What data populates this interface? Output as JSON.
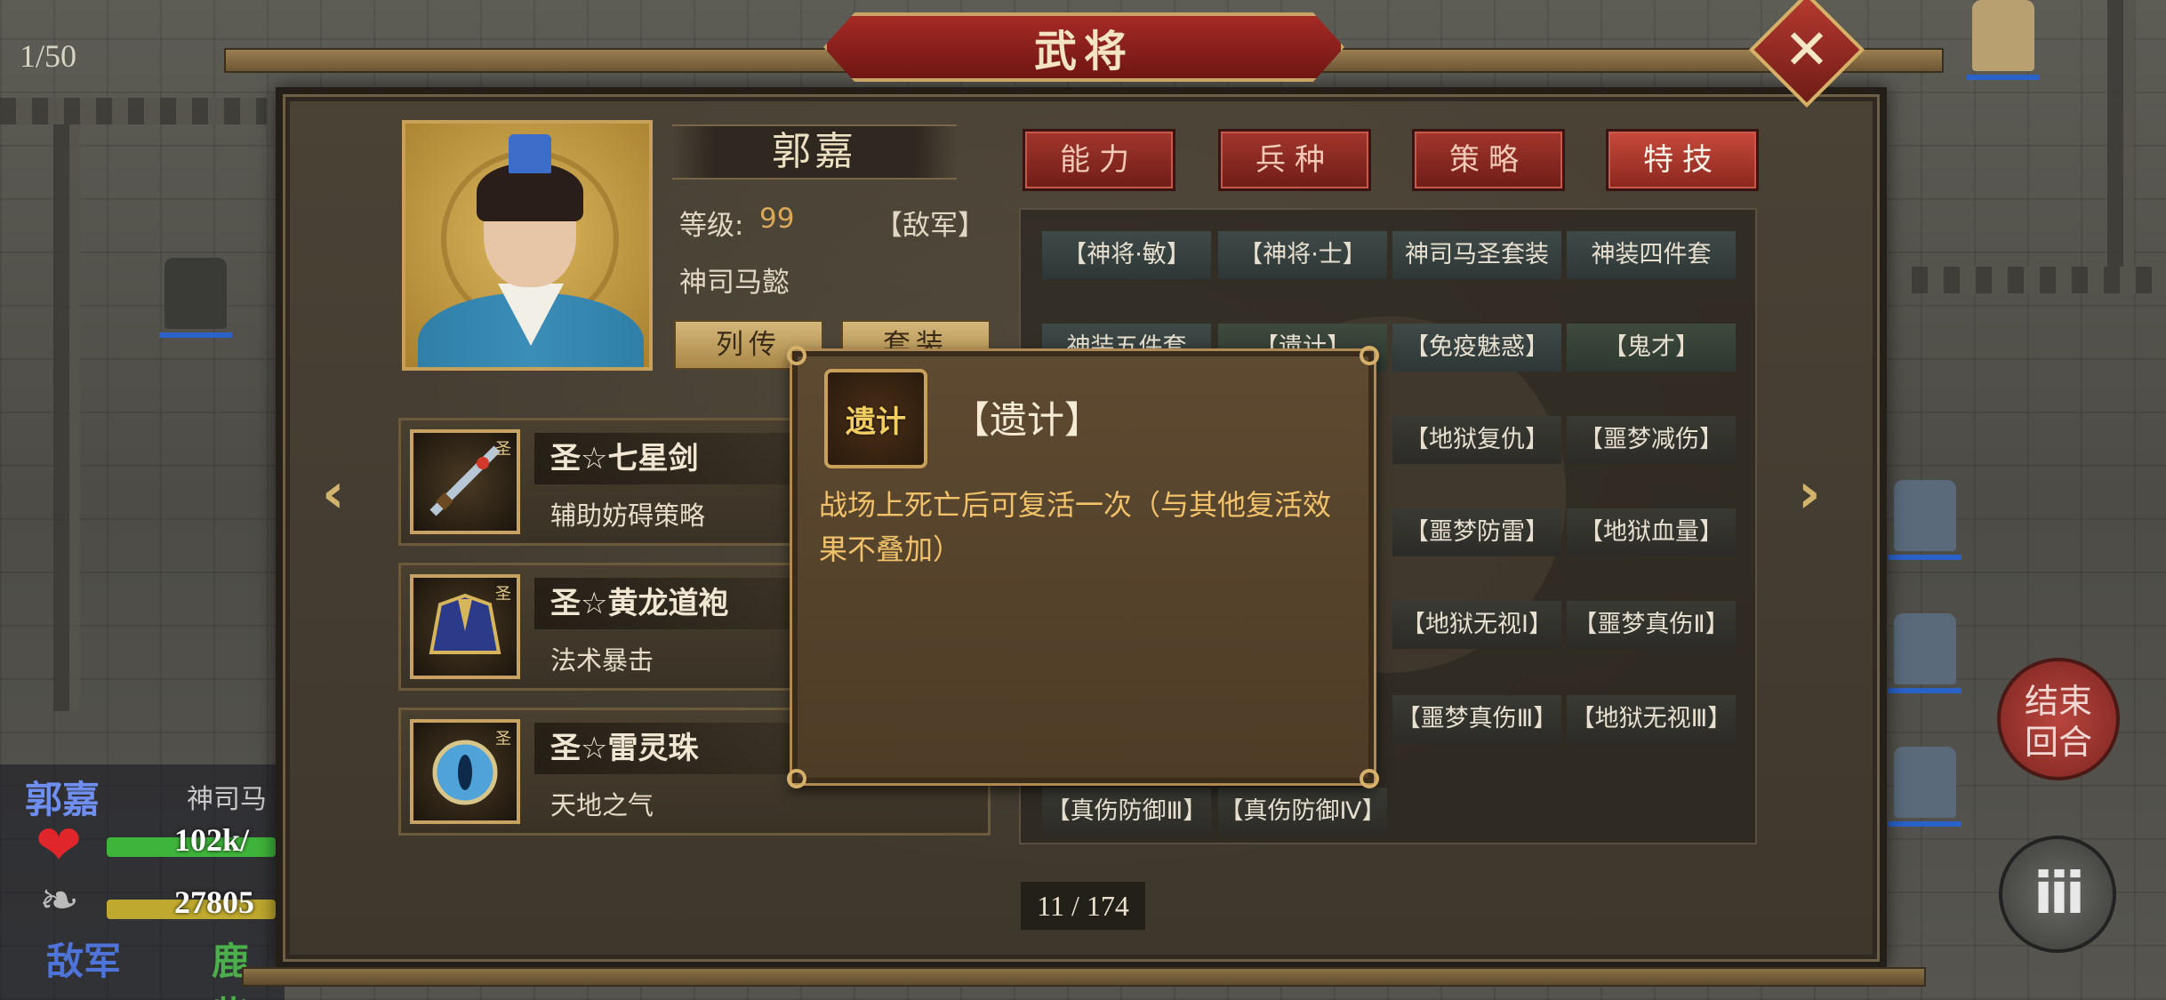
{
  "hud": {
    "turn_counter": "1/50",
    "selected_unit": {
      "name": "郭嘉",
      "alias_partial": "神司马",
      "hp_partial": "102k/",
      "mp_partial": "27805",
      "side": "敌军",
      "location_partial": "鹿柴"
    },
    "end_turn_label": "结束\n回合",
    "menu_label": "iii"
  },
  "dialog": {
    "title": "武将",
    "close_label": "✕",
    "general": {
      "name": "郭嘉",
      "level_label": "等级:",
      "level_value": "99",
      "faction": "【敌军】",
      "alias": "神司马懿",
      "bio_button": "列传",
      "set_button": "套装"
    },
    "equipment": [
      {
        "name": "圣☆七星剑",
        "effect": "辅助妨碍策略",
        "icon": "sword-icon",
        "mark": "圣"
      },
      {
        "name": "圣☆黄龙道袍",
        "effect": "法术暴击",
        "icon": "robe-icon",
        "mark": "圣"
      },
      {
        "name": "圣☆雷灵珠",
        "effect": "天地之气",
        "icon": "orb-icon",
        "mark": "圣"
      }
    ],
    "tabs": [
      {
        "label": "能力",
        "active": false
      },
      {
        "label": "兵种",
        "active": false
      },
      {
        "label": "策略",
        "active": false
      },
      {
        "label": "特技",
        "active": true
      }
    ],
    "skills": [
      "【神将·敏】",
      "【神将·士】",
      "神司马圣套装",
      "神装四件套",
      "神装五件套",
      "【遗计】",
      "【免疫魅惑】",
      "【鬼才】",
      "【地狱复仇】",
      "【噩梦减伤】",
      "【噩梦防雷】",
      "【地狱血量】",
      "【地狱无视Ⅰ】",
      "【噩梦真伤Ⅱ】",
      "【噩梦真伤Ⅲ】",
      "【地狱无视Ⅲ】",
      "【真伤防御Ⅲ】",
      "【真伤防御Ⅳ】"
    ],
    "page_indicator": "11 / 174",
    "tooltip": {
      "icon_text": "遗计",
      "title": "【遗计】",
      "description": "战场上死亡后可复活一次（与其他复活效果不叠加）"
    }
  },
  "colors": {
    "tab_red": "#a2362c",
    "gold": "#c9a05a",
    "tooltip_text": "#f1c26a"
  }
}
